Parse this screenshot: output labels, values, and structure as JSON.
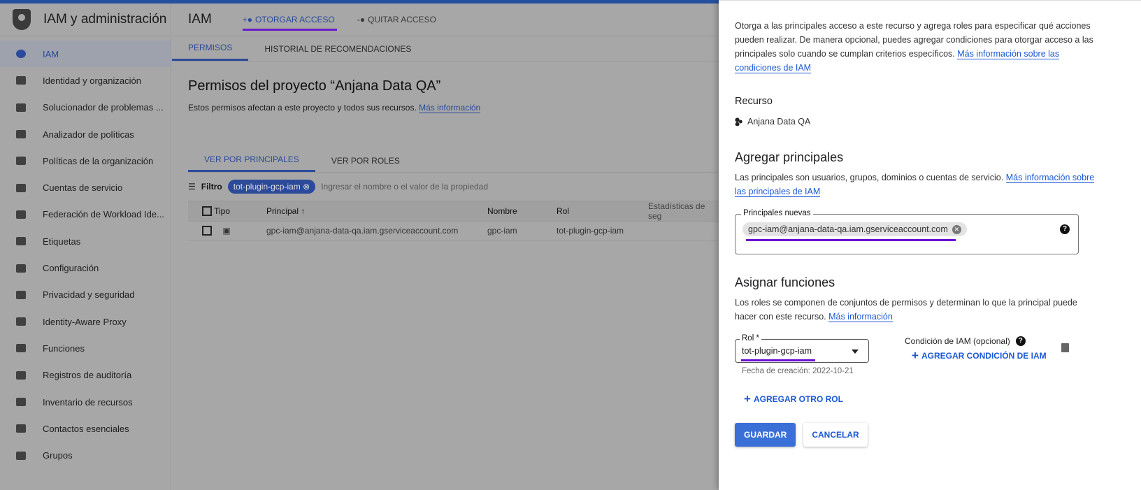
{
  "app": {
    "title": "IAM y administración"
  },
  "sidebar": {
    "items": [
      {
        "label": "IAM",
        "icon": "person-add-icon",
        "active": true
      },
      {
        "label": "Identidad y organización",
        "icon": "account-circle-icon"
      },
      {
        "label": "Solucionador de problemas ...",
        "icon": "wrench-icon"
      },
      {
        "label": "Analizador de políticas",
        "icon": "policy-analyzer-icon"
      },
      {
        "label": "Políticas de la organización",
        "icon": "document-icon"
      },
      {
        "label": "Cuentas de servicio",
        "icon": "service-account-icon"
      },
      {
        "label": "Federación de Workload Ide...",
        "icon": "id-card-icon"
      },
      {
        "label": "Etiquetas",
        "icon": "tag-icon"
      },
      {
        "label": "Configuración",
        "icon": "gear-icon"
      },
      {
        "label": "Privacidad y seguridad",
        "icon": "shield-icon"
      },
      {
        "label": "Identity-Aware Proxy",
        "icon": "proxy-icon"
      },
      {
        "label": "Funciones",
        "icon": "hat-icon"
      },
      {
        "label": "Registros de auditoría",
        "icon": "list-icon"
      },
      {
        "label": "Inventario de recursos",
        "icon": "inventory-icon"
      },
      {
        "label": "Contactos esenciales",
        "icon": "contact-icon"
      },
      {
        "label": "Grupos",
        "icon": "group-icon"
      }
    ]
  },
  "header": {
    "title": "IAM",
    "grant": "OTORGAR ACCESO",
    "remove": "QUITAR ACCESO"
  },
  "tabs": [
    "PERMISOS",
    "HISTORIAL DE RECOMENDACIONES"
  ],
  "page": {
    "title": "Permisos del proyecto “Anjana Data QA”",
    "desc": "Estos permisos afectan a este proyecto y todos sus recursos.",
    "more": "Más información"
  },
  "viewtabs": [
    "VER POR PRINCIPALES",
    "VER POR ROLES"
  ],
  "filter": {
    "label": "Filtro",
    "chip": "tot-plugin-gcp-iam",
    "placeholder": "Ingresar el nombre o el valor de la propiedad"
  },
  "table": {
    "headers": [
      "Tipo",
      "Principal",
      "Nombre",
      "Rol",
      "Estadísticas de seg"
    ],
    "rows": [
      {
        "principal": "gpc-iam@anjana-data-qa.iam.gserviceaccount.com",
        "name": "gpc-iam",
        "role": "tot-plugin-gcp-iam"
      }
    ]
  },
  "panel": {
    "intro": "Otorga a las principales acceso a este recurso y agrega roles para especificar qué acciones pueden realizar. De manera opcional, puedes agregar condiciones para otorgar acceso a las principales solo cuando se cumplan criterios específicos.",
    "intro_link": "Más información sobre las condiciones de IAM",
    "resource_label": "Recurso",
    "resource": "Anjana Data QA",
    "add_title": "Agregar principales",
    "add_desc": "Las principales son usuarios, grupos, dominios o cuentas de servicio.",
    "add_link": "Más información sobre las principales de IAM",
    "new_label": "Principales nuevas",
    "new_value": "gpc-iam@anjana-data-qa.iam.gserviceaccount.com",
    "assign_title": "Asignar funciones",
    "assign_desc": "Los roles se componen de conjuntos de permisos y determinan lo que la principal puede hacer con este recurso.",
    "assign_link": "Más información",
    "role_label": "Rol *",
    "role_value": "tot-plugin-gcp-iam",
    "role_hint": "Fecha de creación: 2022-10-21",
    "cond_label": "Condición de IAM (opcional)",
    "add_cond": "AGREGAR CONDICIÓN DE IAM",
    "add_role": "AGREGAR OTRO ROL",
    "save": "GUARDAR",
    "cancel": "CANCELAR"
  }
}
